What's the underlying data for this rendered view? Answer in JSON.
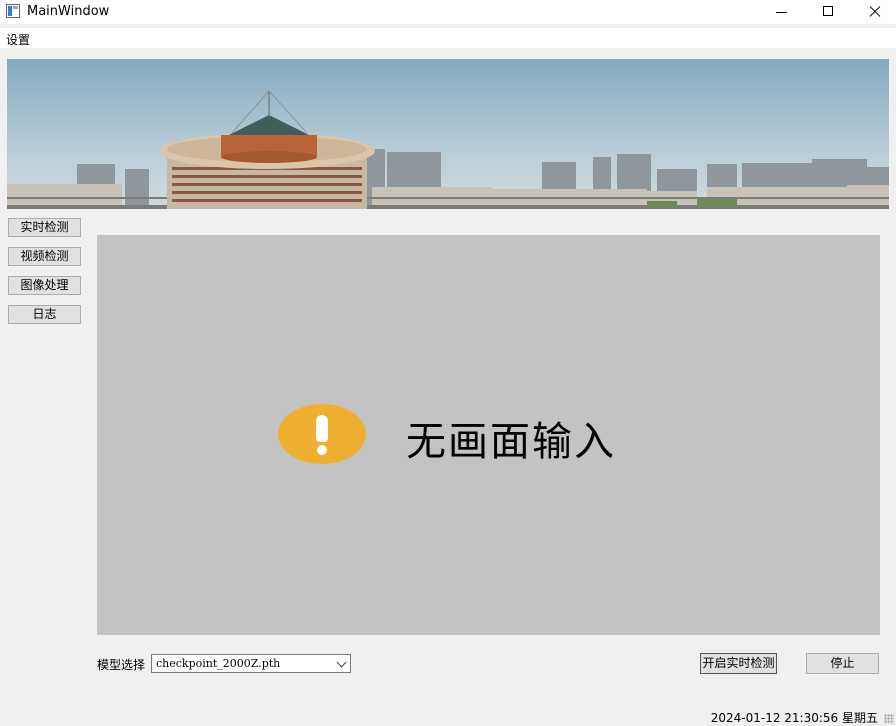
{
  "window": {
    "title": "MainWindow"
  },
  "menubar": {
    "settings_label": "设置"
  },
  "sidebar": {
    "items": [
      {
        "label": "实时检测"
      },
      {
        "label": "视频检测"
      },
      {
        "label": "图像处理"
      },
      {
        "label": "日志"
      }
    ]
  },
  "video": {
    "message": "无画面输入",
    "icon": "warning-icon",
    "background_color": "#c3c3c3",
    "icon_color": "#efb031"
  },
  "controls": {
    "model_label": "模型选择",
    "model_selected": "checkpoint_2000Z.pth",
    "start_label": "开启实时检测",
    "stop_label": "停止"
  },
  "statusbar": {
    "datetime": "2024-01-12 21:30:56 星期五"
  }
}
